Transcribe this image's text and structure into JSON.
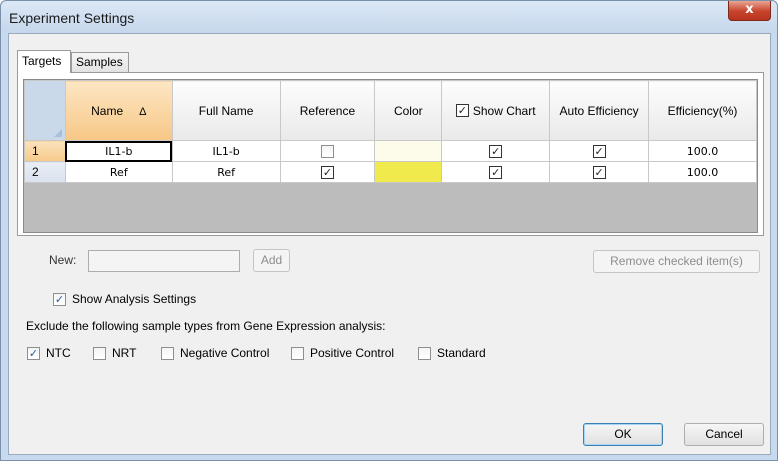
{
  "window": {
    "title": "Experiment Settings",
    "close_glyph": "x"
  },
  "tabs": [
    {
      "label": "Targets",
      "active": true
    },
    {
      "label": "Samples",
      "active": false
    }
  ],
  "grid": {
    "columns": {
      "name": "Name",
      "sort_glyph": "Δ",
      "full_name": "Full Name",
      "reference": "Reference",
      "color": "Color",
      "show_chart": "Show Chart",
      "auto_efficiency": "Auto Efficiency",
      "efficiency": "Efficiency(%)"
    },
    "rows": [
      {
        "num": "1",
        "name": "IL1-b",
        "full_name": "IL1-b",
        "reference": false,
        "color": "#fdfbea",
        "show_chart": true,
        "auto_efficiency": true,
        "efficiency": "100.0"
      },
      {
        "num": "2",
        "name": "Ref",
        "full_name": "Ref",
        "reference": true,
        "color": "#f1ea4c",
        "show_chart": true,
        "auto_efficiency": true,
        "efficiency": "100.0"
      }
    ]
  },
  "new_item": {
    "label": "New:",
    "value": "",
    "add_label": "Add"
  },
  "remove_label": "Remove checked item(s)",
  "show_analysis": {
    "label": "Show Analysis Settings",
    "checked": true
  },
  "exclude_heading": "Exclude the following sample types from Gene Expression analysis:",
  "exclude_options": [
    {
      "label": "NTC",
      "checked": true
    },
    {
      "label": "NRT",
      "checked": false
    },
    {
      "label": "Negative Control",
      "checked": false
    },
    {
      "label": "Positive Control",
      "checked": false
    },
    {
      "label": "Standard",
      "checked": false
    }
  ],
  "buttons": {
    "ok": "OK",
    "cancel": "Cancel"
  },
  "check_glyph": "✓"
}
